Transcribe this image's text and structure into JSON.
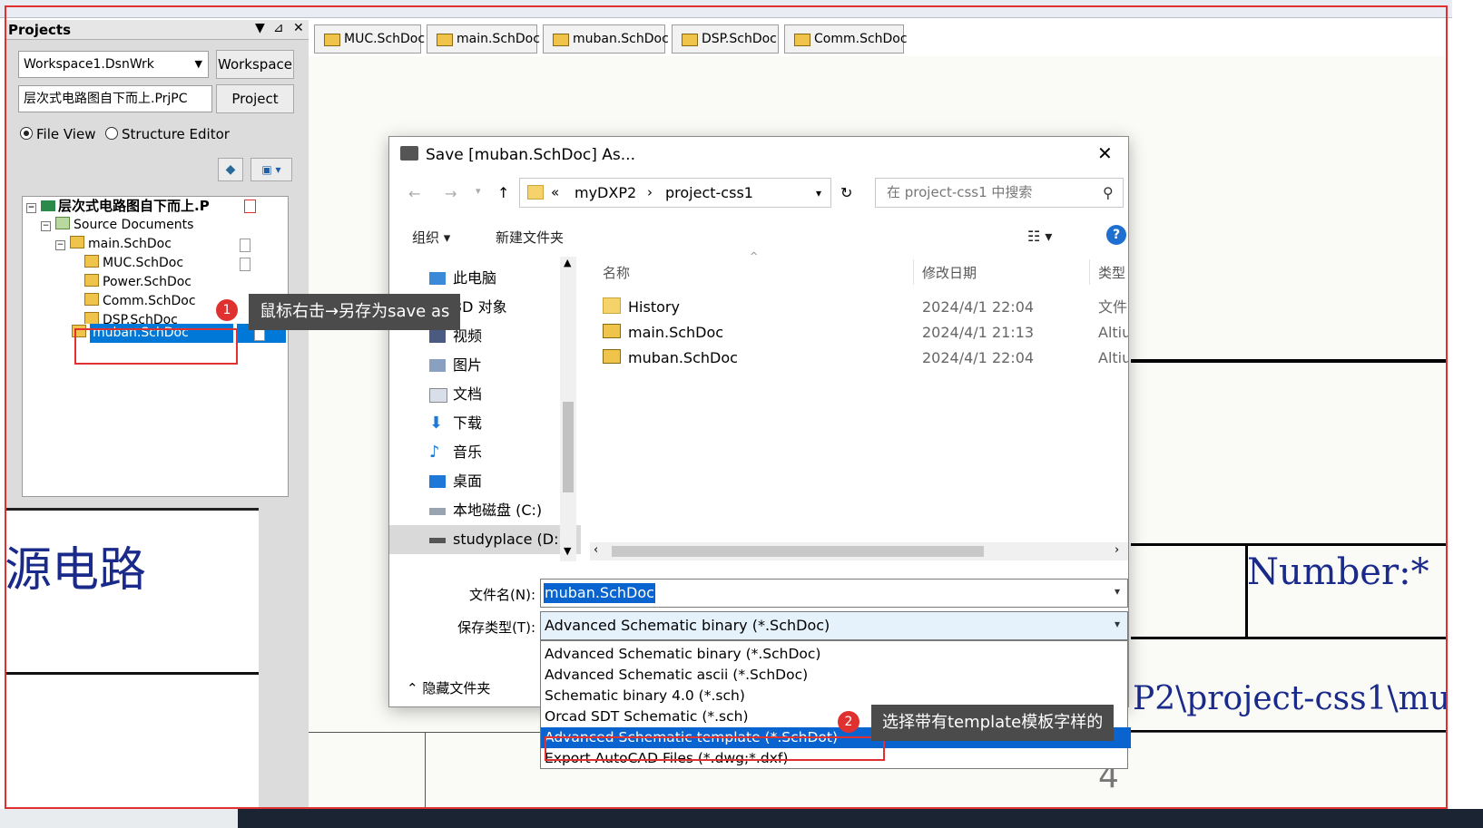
{
  "panel": {
    "title": "Projects",
    "workspace_combo": "Workspace1.DsnWrk",
    "workspace_button": "Workspace",
    "project_combo": "层次式电路图自下而上.PrjPC",
    "project_button": "Project",
    "radio_file_view": "File View",
    "radio_structure_editor": "Structure Editor"
  },
  "tree": {
    "root": "层次式电路图自下而上.P",
    "source_docs": "Source Documents",
    "items": [
      "main.SchDoc",
      "MUC.SchDoc",
      "Power.SchDoc",
      "Comm.SchDoc",
      "DSP.SchDoc",
      "muban.SchDoc"
    ]
  },
  "tabs": [
    "MUC.SchDoc",
    "main.SchDoc",
    "muban.SchDoc",
    "DSP.SchDoc",
    "Comm.SchDoc"
  ],
  "schematic": {
    "left_big_text": "源电路",
    "number_label": "Number:*",
    "path_text": "P2\\project-css1\\mu",
    "sheet_number": "4"
  },
  "dialog": {
    "title": "Save [muban.SchDoc] As...",
    "breadcrumb": [
      "«",
      "myDXP2",
      "›",
      "project-css1"
    ],
    "search_placeholder": "在 project-css1 中搜索",
    "toolbar_organize": "组织 ▾",
    "toolbar_new_folder": "新建文件夹",
    "help": "?",
    "nav_items": [
      "此电脑",
      "3D 对象",
      "视频",
      "图片",
      "文档",
      "下载",
      "音乐",
      "桌面",
      "本地磁盘 (C:)",
      "studyplace (D:)"
    ],
    "columns": {
      "name": "名称",
      "date": "修改日期",
      "type": "类型"
    },
    "files": [
      {
        "name": "History",
        "date": "2024/4/1 22:04",
        "type": "文件夹"
      },
      {
        "name": "main.SchDoc",
        "date": "2024/4/1 21:13",
        "type": "Altium"
      },
      {
        "name": "muban.SchDoc",
        "date": "2024/4/1 22:04",
        "type": "Altium"
      }
    ],
    "filename_label": "文件名(N):",
    "filename_value": "muban.SchDoc",
    "filetype_label": "保存类型(T):",
    "filetype_value": "Advanced Schematic binary (*.SchDoc)",
    "hide_folders": "隐藏文件夹",
    "type_options": [
      "Advanced Schematic binary (*.SchDoc)",
      "Advanced Schematic ascii (*.SchDoc)",
      "Schematic binary 4.0 (*.sch)",
      "Orcad SDT Schematic (*.sch)",
      "Advanced Schematic template (*.SchDot)",
      "Export AutoCAD Files (*.dwg;*.dxf)"
    ],
    "selected_option_index": 4
  },
  "annotations": {
    "step1_number": "1",
    "step1_text": "鼠标右击→另存为save  as",
    "step2_number": "2",
    "step2_text": "选择带有template模板字样的"
  },
  "colors": {
    "annotation_red": "#e03131",
    "selection_blue": "#0a64d0",
    "tree_selection": "#0078d7",
    "callout_bg": "#4b4b4b"
  }
}
